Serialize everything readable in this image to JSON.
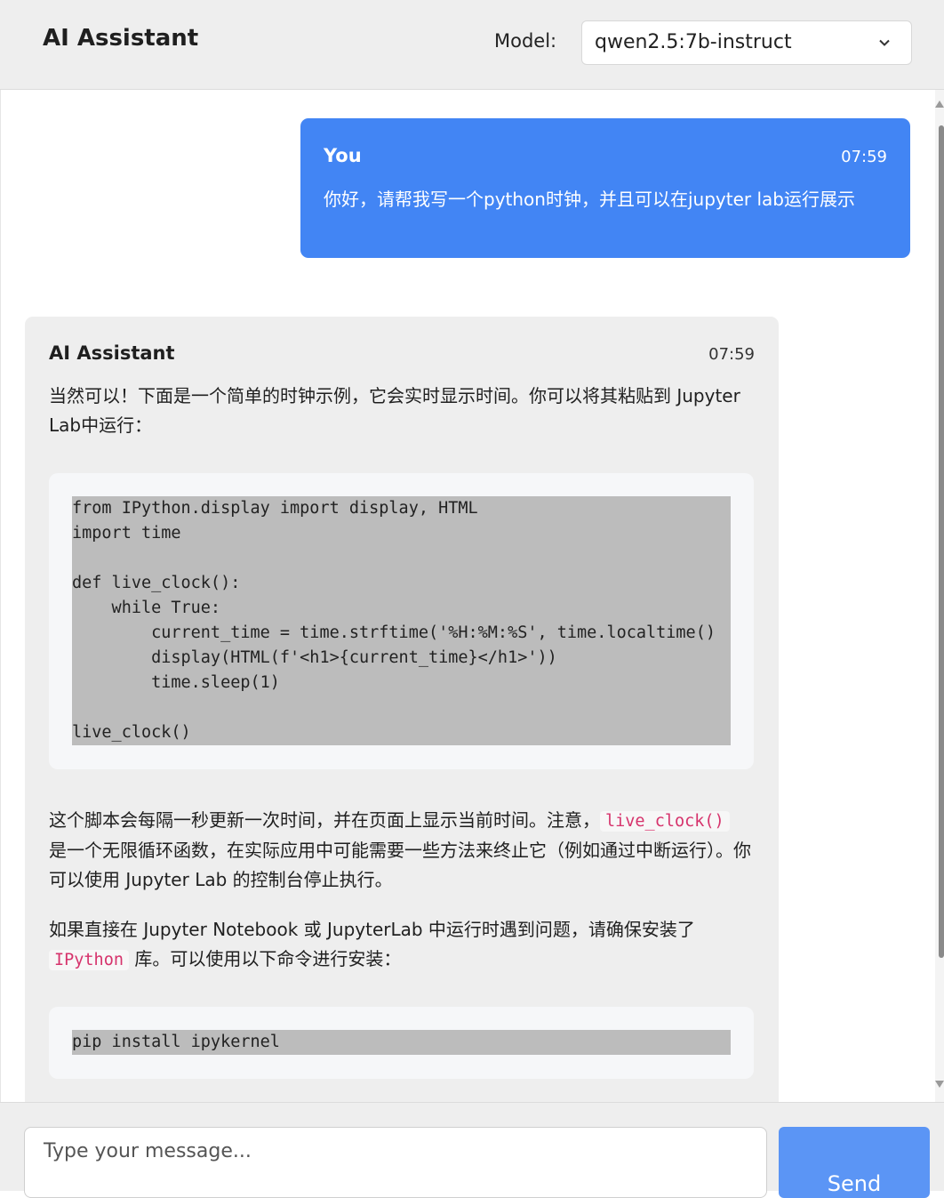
{
  "header": {
    "title": "AI Assistant",
    "model_label": "Model:",
    "model_value": "qwen2.5:7b-instruct",
    "dropdown_icon": "chevron-down-icon"
  },
  "messages": [
    {
      "role": "user",
      "sender": "You",
      "time": "07:59",
      "text": "你好，请帮我写一个python时钟，并且可以在jupyter lab运行展示",
      "bg_color": "#4285f4"
    },
    {
      "role": "assistant",
      "sender": "AI Assistant",
      "time": "07:59",
      "intro": "当然可以！下面是一个简单的时钟示例，它会实时显示时间。你可以将其粘贴到 Jupyter Lab中运行：",
      "code_block_1": [
        "from IPython.display import display, HTML",
        "import time",
        "",
        "def live_clock():",
        "    while True:",
        "        current_time = time.strftime('%H:%M:%S', time.localtime()",
        "        display(HTML(f'<h1>{current_time}</h1>'))",
        "        time.sleep(1)",
        "",
        "live_clock()"
      ],
      "p2_before": "这个脚本会每隔一秒更新一次时间，并在页面上显示当前时间。注意，",
      "p2_code": "live_clock()",
      "p2_after": " 是一个无限循环函数，在实际应用中可能需要一些方法来终止它（例如通过中断运行）。你可以使用 Jupyter Lab 的控制台停止执行。",
      "p3_before": "如果直接在 Jupyter Notebook 或 JupyterLab 中运行时遇到问题，请确保安装了 ",
      "p3_code": "IPython",
      "p3_after": " 库。可以使用以下命令进行安装：",
      "code_block_2": [
        "pip install ipykernel"
      ]
    }
  ],
  "input": {
    "placeholder": "Type your message...",
    "send_label": "Send"
  },
  "colors": {
    "accent": "#4285f4",
    "send_button": "#5b95f5",
    "inline_code": "#d6336c",
    "code_highlight": "#bcbcbc"
  }
}
